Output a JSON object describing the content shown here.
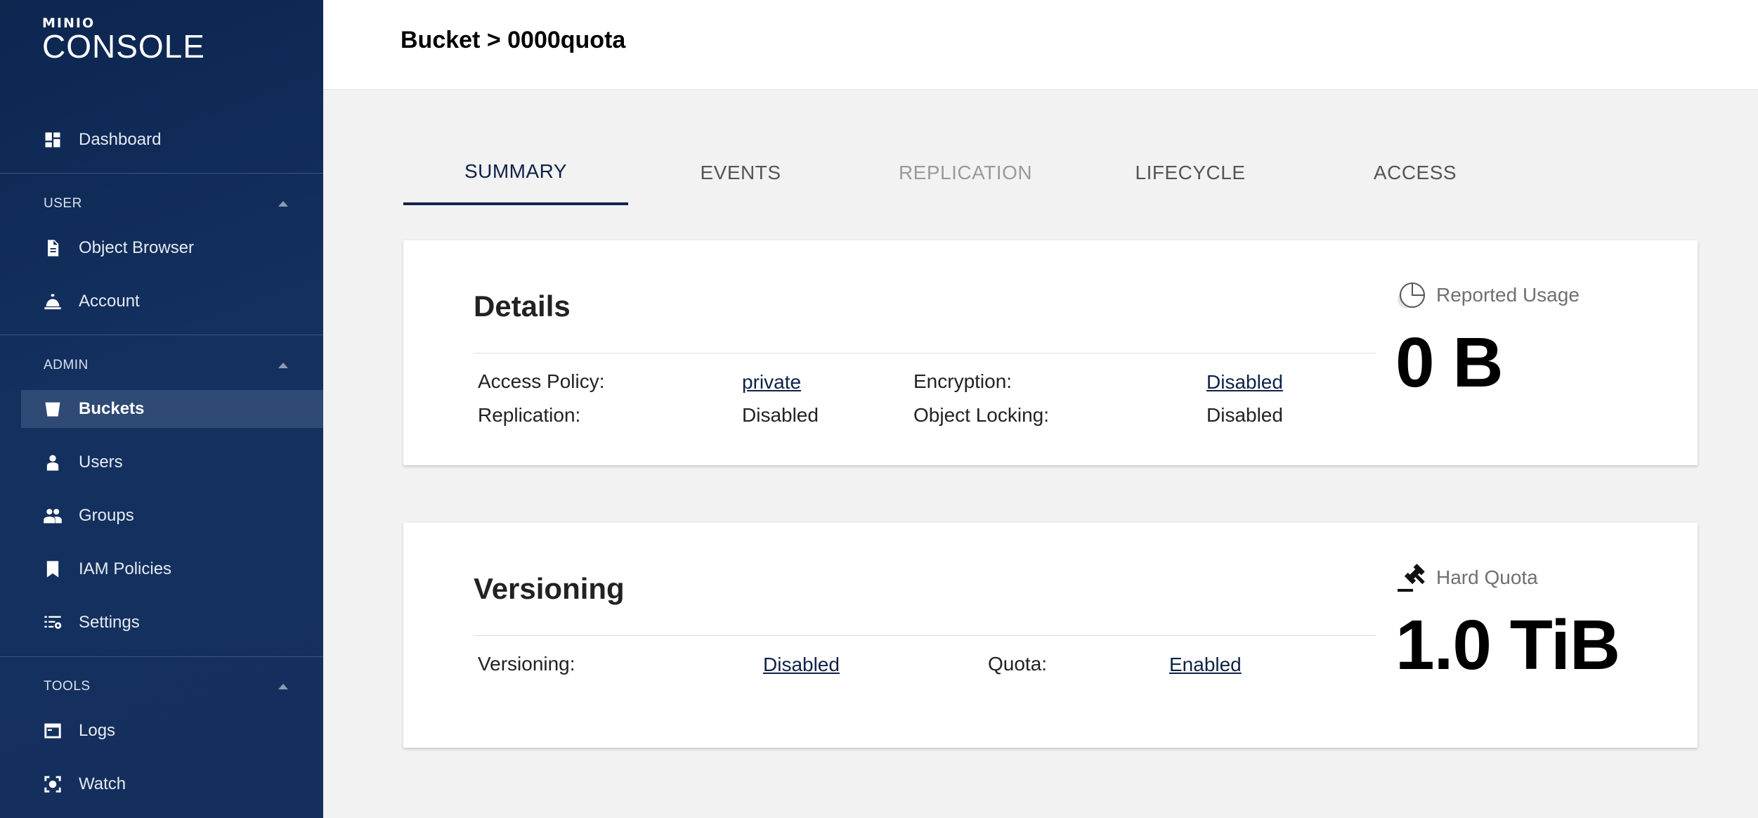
{
  "sidebar": {
    "logo": {
      "brand": "MINIO",
      "product": "CONSOLE"
    },
    "dashboard": {
      "label": "Dashboard",
      "icon": "dashboard-icon"
    },
    "user_section": {
      "title": "USER",
      "items": [
        {
          "label": "Object Browser",
          "icon": "document-icon"
        },
        {
          "label": "Account",
          "icon": "bell-icon"
        }
      ]
    },
    "admin_section": {
      "title": "ADMIN",
      "items": [
        {
          "label": "Buckets",
          "icon": "bucket-icon",
          "active": true
        },
        {
          "label": "Users",
          "icon": "user-icon"
        },
        {
          "label": "Groups",
          "icon": "group-icon"
        },
        {
          "label": "IAM Policies",
          "icon": "bookmark-icon"
        },
        {
          "label": "Settings",
          "icon": "settings-icon"
        }
      ]
    },
    "tools_section": {
      "title": "TOOLS",
      "items": [
        {
          "label": "Logs",
          "icon": "logs-icon"
        },
        {
          "label": "Watch",
          "icon": "watch-icon"
        }
      ]
    }
  },
  "header": {
    "breadcrumb": "Bucket > 0000quota"
  },
  "tabs": [
    {
      "label": "SUMMARY",
      "state": "active"
    },
    {
      "label": "EVENTS",
      "state": "normal"
    },
    {
      "label": "REPLICATION",
      "state": "disabled"
    },
    {
      "label": "LIFECYCLE",
      "state": "normal"
    },
    {
      "label": "ACCESS",
      "state": "normal"
    }
  ],
  "details": {
    "title": "Details",
    "access_policy_label": "Access Policy:",
    "access_policy_value": "private",
    "encryption_label": "Encryption:",
    "encryption_value": "Disabled",
    "replication_label": "Replication:",
    "replication_value": "Disabled",
    "object_locking_label": "Object Locking:",
    "object_locking_value": "Disabled",
    "usage_label": "Reported Usage",
    "usage_value": "0 B"
  },
  "versioning": {
    "title": "Versioning",
    "versioning_label": "Versioning:",
    "versioning_value": "Disabled",
    "quota_label": "Quota:",
    "quota_value": "Enabled",
    "hard_quota_label": "Hard Quota",
    "hard_quota_value": "1.0 TiB"
  },
  "colors": {
    "sidebar_bg": "#13305f",
    "active_item": "#2e4a75",
    "accent": "#0e2247",
    "page_bg": "#f2f2f2"
  }
}
